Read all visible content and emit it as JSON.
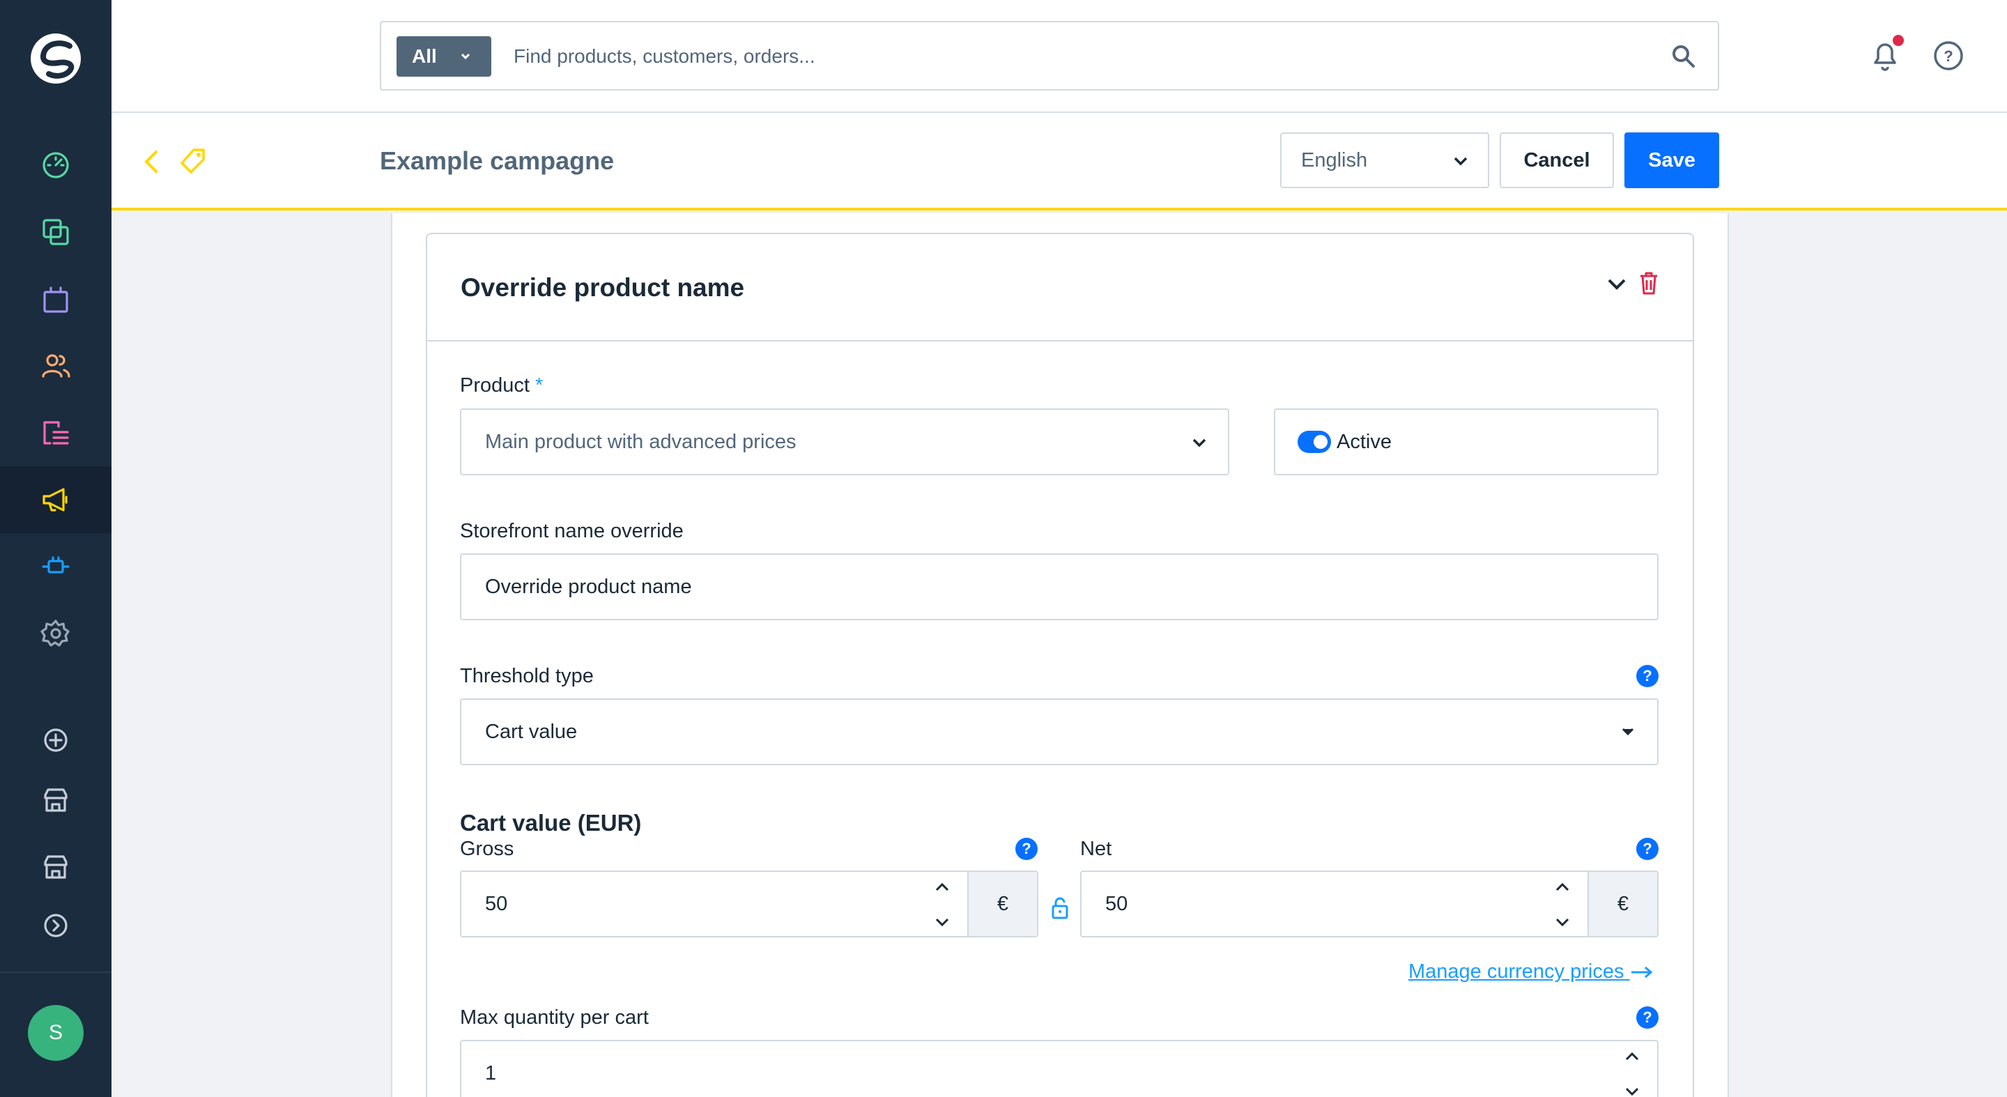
{
  "search": {
    "type_label": "All",
    "placeholder": "Find products, customers, orders..."
  },
  "smartbar": {
    "title": "Example campagne",
    "language": "English",
    "cancel_label": "Cancel",
    "save_label": "Save"
  },
  "sidebar": {
    "items": [
      {
        "name": "dashboard-icon",
        "color": "#57d9a3"
      },
      {
        "name": "catalogues-icon",
        "color": "#57d9a3"
      },
      {
        "name": "orders-icon",
        "color": "#a092f0"
      },
      {
        "name": "customers-icon",
        "color": "#ffab71"
      },
      {
        "name": "content-icon",
        "color": "#ff68b4"
      },
      {
        "name": "marketing-icon",
        "color": "#ffd700"
      },
      {
        "name": "extensions-icon",
        "color": "#189eff"
      },
      {
        "name": "settings-icon",
        "color": "#9aa8b5"
      }
    ],
    "avatar_initial": "S"
  },
  "card": {
    "title": "Override product name",
    "product_label": "Product",
    "required_mark": "*",
    "product_value": "Main product with advanced prices",
    "active_label": "Active",
    "active": true,
    "storefront_label": "Storefront name override",
    "storefront_value": "Override product name",
    "threshold_label": "Threshold type",
    "threshold_value": "Cart value",
    "cart_value_heading": "Cart value (EUR)",
    "gross_label": "Gross",
    "gross_value": "50",
    "net_label": "Net",
    "net_value": "50",
    "currency_symbol": "€",
    "manage_link": "Manage currency prices",
    "max_qty_label": "Max quantity per cart",
    "max_qty_value": "1",
    "help_mark": "?"
  },
  "colors": {
    "accent": "#0870ff",
    "sidebar": "#1b2c3e",
    "smartbar_border": "#ffd700",
    "delete": "#de294c"
  }
}
